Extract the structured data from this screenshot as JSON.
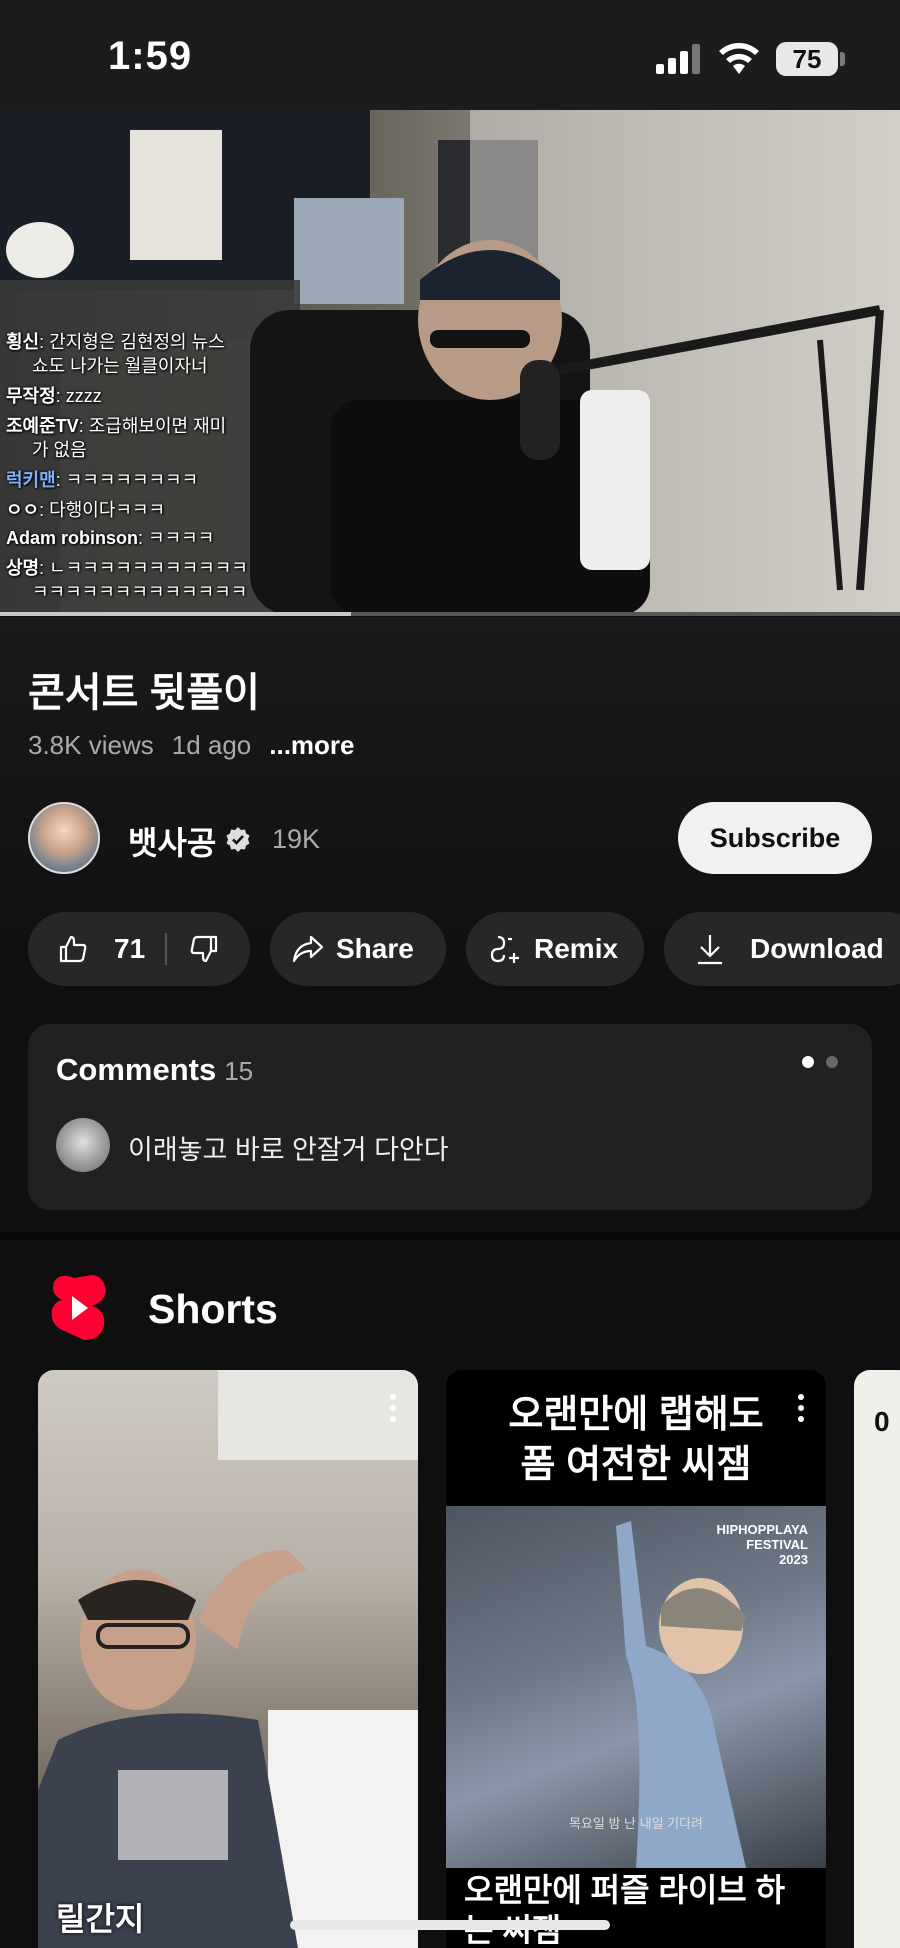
{
  "status_bar": {
    "time": "1:59",
    "battery": "75"
  },
  "video": {
    "chat": [
      {
        "name": "횡신",
        "message": "간지형은 김현정의 뉴스"
      },
      {
        "name": "",
        "message": "쇼도 나가는 월클이자너"
      },
      {
        "name": "무작정",
        "message": "zzzz"
      },
      {
        "name": "조예준TV",
        "message": "조급해보이면 재미"
      },
      {
        "name": "",
        "message": "가 없음"
      },
      {
        "name": "럭키맨",
        "message": "ㅋㅋㅋㅋㅋㅋㅋㅋ"
      },
      {
        "name": "ㅇㅇ",
        "message": "다행이다ㅋㅋㅋ"
      },
      {
        "name": "Adam robinson",
        "message": "ㅋㅋㅋㅋ"
      },
      {
        "name": "상명",
        "message": "ㄴㅋㅋㅋㅋㅋㅋㅋㅋㅋㅋㅋ"
      },
      {
        "name": "",
        "message": "ㅋㅋㅋㅋㅋㅋㅋㅋㅋㅋㅋㅋㅋ"
      }
    ],
    "progress": 0.39
  },
  "info": {
    "title": "콘서트 뒷풀이",
    "views": "3.8K views",
    "age": "1d ago",
    "more": "...more"
  },
  "channel": {
    "name": "뱃사공",
    "subscribers": "19K",
    "subscribe_label": "Subscribe"
  },
  "actions": {
    "likes": "71",
    "share": "Share",
    "remix": "Remix",
    "download": "Download"
  },
  "comments": {
    "title": "Comments",
    "count": "15",
    "top_comment": "이래놓고 바로 안잘거 다안다"
  },
  "shorts": {
    "title": "Shorts",
    "items": [
      {
        "title": "릴간지"
      },
      {
        "top_text_1": "오랜만에 랩해도",
        "top_text_2": "폼 여전한 씨잼",
        "festival_1": "HIPHOPPLAYA",
        "festival_2": "FESTIVAL",
        "festival_3": "2023",
        "caption": "목요일 밤 난 내일 기다려",
        "title": "오랜만에 퍼즐 라이브 하는 씨잼"
      },
      {
        "partial": "0"
      }
    ]
  },
  "icons": {
    "verified": "verified-badge-icon",
    "like": "thumbs-up-icon",
    "dislike": "thumbs-down-icon",
    "share": "share-arrow-icon",
    "remix": "remix-icon",
    "download": "download-icon",
    "shorts": "shorts-logo-icon"
  },
  "colors": {
    "background": "#0f0f0f",
    "pill": "#272727",
    "shorts_red": "#ff0033"
  }
}
